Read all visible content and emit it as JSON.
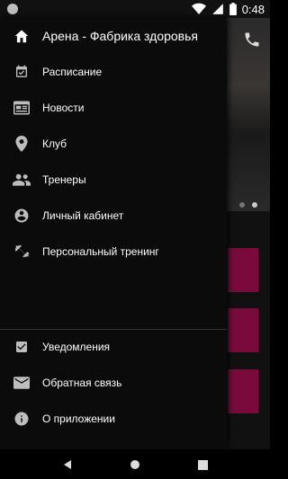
{
  "status_bar": {
    "time": "0:48"
  },
  "drawer": {
    "header": {
      "title": "Арена - Фабрика здоровья",
      "icon": "home-icon"
    },
    "items": [
      {
        "label": "Расписание",
        "icon": "calendar-check-icon"
      },
      {
        "label": "Новости",
        "icon": "newspaper-icon"
      },
      {
        "label": "Клуб",
        "icon": "location-pin-icon"
      },
      {
        "label": "Тренеры",
        "icon": "people-icon"
      },
      {
        "label": "Личный кабинет",
        "icon": "account-circle-icon"
      },
      {
        "label": "Персональный тренинг",
        "icon": "dumbbell-icon"
      }
    ],
    "bottom_items": [
      {
        "label": "Уведомления",
        "icon": "check-box-icon"
      },
      {
        "label": "Обратная связь",
        "icon": "email-icon"
      },
      {
        "label": "О приложении",
        "icon": "info-icon"
      }
    ]
  },
  "colors": {
    "accent": "#7a0a3c",
    "drawer_bg": "#0b0b0b",
    "icon": "#bdbdbd"
  }
}
